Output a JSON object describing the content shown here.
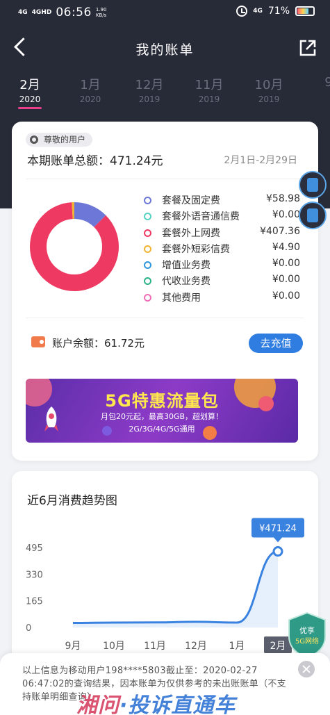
{
  "status_bar": {
    "network_left": "4G",
    "network_right": "4GHD",
    "time": "06:56",
    "speed_value": "1.90",
    "speed_unit": "KB/s",
    "signal_right": "4G",
    "battery": "71%"
  },
  "nav": {
    "title": "我的账单",
    "back_icon": "chevron-left-icon",
    "share_icon": "share-icon"
  },
  "months": [
    {
      "month": "2月",
      "year": "2020",
      "active": true
    },
    {
      "month": "1月",
      "year": "2020",
      "active": false
    },
    {
      "month": "12月",
      "year": "2019",
      "active": false
    },
    {
      "month": "11月",
      "year": "2019",
      "active": false
    },
    {
      "month": "10月",
      "year": "2019",
      "active": false
    },
    {
      "month": "9",
      "year": "",
      "active": false
    }
  ],
  "bill": {
    "vip_tag": "尊敬的用户",
    "total_label": "本期账单总额：471.24元",
    "date_range": "2月1日-2月29日",
    "breakdown": [
      {
        "label": "套餐及固定费",
        "value": "¥58.98",
        "color": "#6d77d8"
      },
      {
        "label": "套餐外语音通信费",
        "value": "¥0.00",
        "color": "#55d3c2"
      },
      {
        "label": "套餐外上网费",
        "value": "¥407.36",
        "color": "#ee3a62"
      },
      {
        "label": "套餐外短彩信费",
        "value": "¥4.90",
        "color": "#f2b431"
      },
      {
        "label": "增值业务费",
        "value": "¥0.00",
        "color": "#2f97dd"
      },
      {
        "label": "代收业务费",
        "value": "¥0.00",
        "color": "#2db489"
      },
      {
        "label": "其他费用",
        "value": "¥0.00",
        "color": "#ef6fb7"
      }
    ],
    "balance_label": "账户余额：61.72元",
    "recharge_button": "去充值"
  },
  "banner": {
    "title": "5G特惠流量包",
    "subtitle": "月包20元起，最高30GB，超划算！",
    "networks": "2G/3G/4G/5G通用"
  },
  "trend": {
    "title": "近6月消费趋势图",
    "highlight_label": "¥471.24"
  },
  "chart_data": {
    "type": "area",
    "title": "近6月消费趋势图",
    "categories": [
      "9月",
      "10月",
      "11月",
      "12月",
      "1月",
      "2月"
    ],
    "values": [
      28,
      30,
      31,
      35,
      30,
      471.24
    ],
    "y_ticks": [
      "495",
      "330",
      "165",
      "0"
    ],
    "ylim": [
      0,
      495
    ],
    "highlight": {
      "category": "2月",
      "label": "¥471.24"
    },
    "line_color": "#3a82e0",
    "grid": false
  },
  "badge": {
    "line1": "优享",
    "line2": "5G网络"
  },
  "notice": {
    "text": "以上信息为移动用户198****5803截止至：2020-02-27 06:47:02的查询结果，因本账单为仅供参考的未出账账单（不支持账单明细查询）",
    "watermark_a": "湘问",
    "watermark_b": "·投诉直通车"
  }
}
